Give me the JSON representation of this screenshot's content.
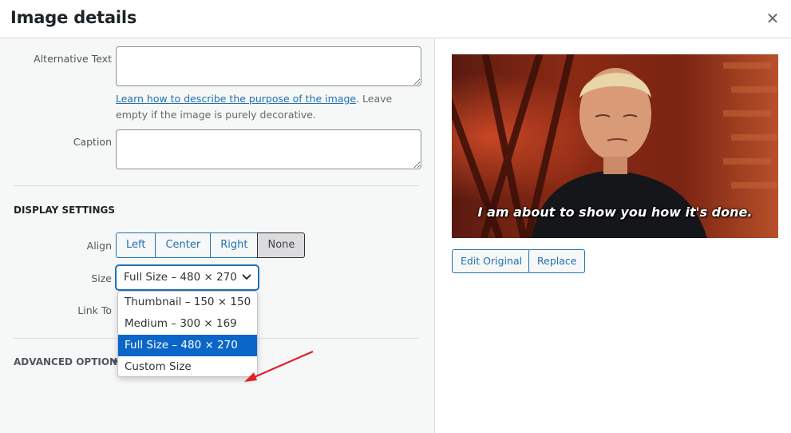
{
  "dialog": {
    "title": "Image details",
    "close_icon": "close-icon"
  },
  "alt_text": {
    "label": "Alternative Text",
    "value": "",
    "help_link": "Learn how to describe the purpose of the image",
    "help_text_after": ". Leave empty if the image is purely decorative."
  },
  "caption": {
    "label": "Caption",
    "value": ""
  },
  "display_settings": {
    "title": "DISPLAY SETTINGS",
    "align": {
      "label": "Align",
      "options": [
        "Left",
        "Center",
        "Right",
        "None"
      ],
      "selected": "None"
    },
    "size": {
      "label": "Size",
      "selected": "Full Size – 480 × 270",
      "options": [
        "Thumbnail – 150 × 150",
        "Medium – 300 × 169",
        "Full Size – 480 × 270",
        "Custom Size"
      ]
    },
    "link_to": {
      "label": "Link To"
    }
  },
  "advanced": {
    "label": "ADVANCED OPTIONS"
  },
  "preview": {
    "subtitle": "I am about to show you how it's done.",
    "edit_button": "Edit Original",
    "replace_button": "Replace"
  },
  "colors": {
    "accent": "#2271b1",
    "selected_option": "#0a66c8",
    "annotation_arrow": "#e0202a"
  }
}
